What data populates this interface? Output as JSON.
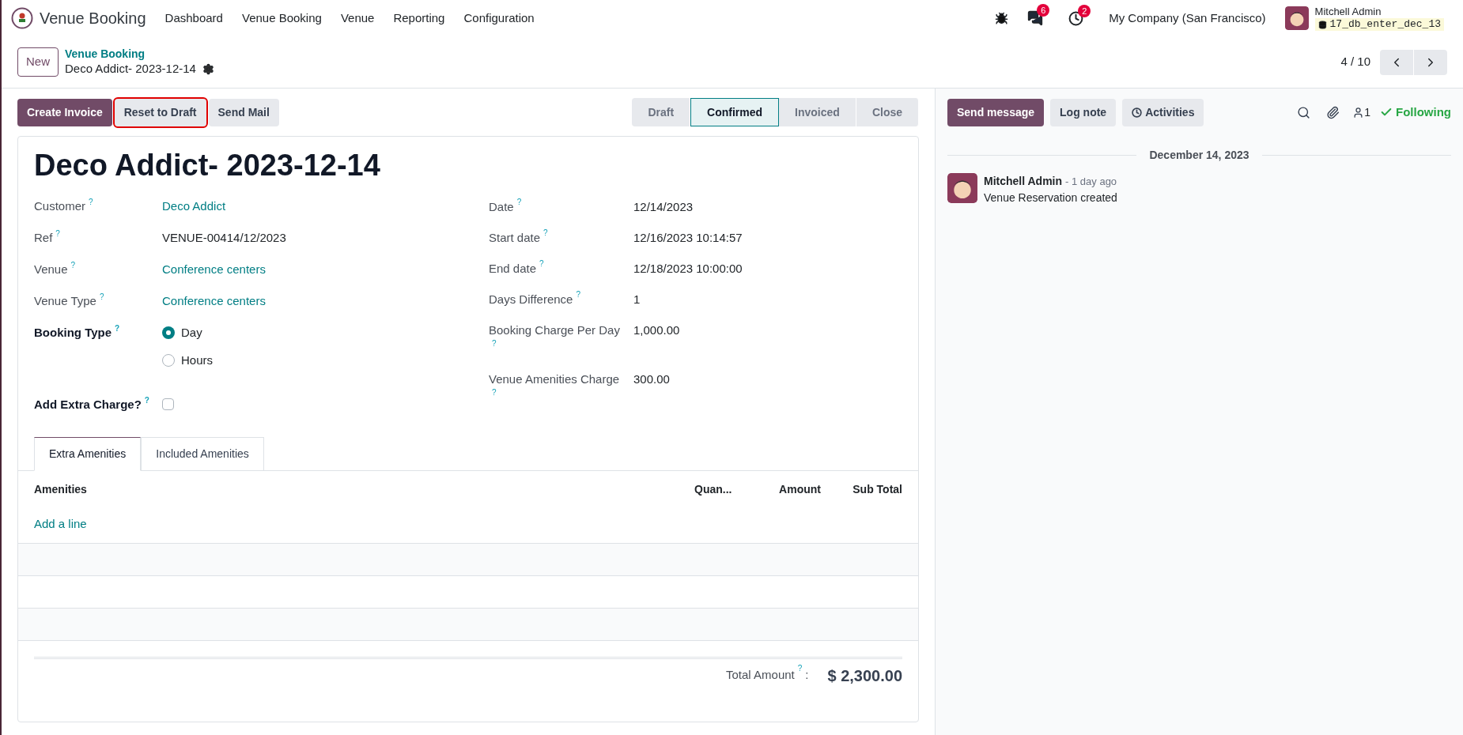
{
  "navbar": {
    "app_name": "Venue Booking",
    "menus": [
      "Dashboard",
      "Venue Booking",
      "Venue",
      "Reporting",
      "Configuration"
    ],
    "messages_count": "6",
    "activities_count": "2",
    "company": "My Company (San Francisco)",
    "user": "Mitchell Admin",
    "database": "17_db_enter_dec_13"
  },
  "control_panel": {
    "new_button": "New",
    "breadcrumb": "Venue Booking",
    "record_name": "Deco Addict- 2023-12-14",
    "pager": "4 / 10"
  },
  "actions": [
    {
      "label": "Create Invoice",
      "kind": "primary",
      "highlighted": false
    },
    {
      "label": "Reset to Draft",
      "kind": "secondary",
      "highlighted": true
    },
    {
      "label": "Send Mail",
      "kind": "secondary",
      "highlighted": false
    }
  ],
  "stages": [
    {
      "label": "Draft",
      "selected": false
    },
    {
      "label": "Confirmed",
      "selected": true
    },
    {
      "label": "Invoiced",
      "selected": false
    },
    {
      "label": "Close",
      "selected": false
    }
  ],
  "form": {
    "title": "Deco Addict- 2023-12-14",
    "help_mark": "?",
    "left_fields": [
      {
        "label": "Customer",
        "kind": "link",
        "value": "Deco Addict"
      },
      {
        "label": "Ref",
        "kind": "text",
        "value": "VENUE-00414/12/2023"
      },
      {
        "label": "Venue",
        "kind": "link",
        "value": "Conference centers"
      },
      {
        "label": "Venue Type",
        "kind": "link",
        "value": "Conference centers"
      },
      {
        "label": "Booking Type",
        "kind": "radio",
        "options": [
          {
            "label": "Day",
            "selected": true
          },
          {
            "label": "Hours",
            "selected": false
          }
        ]
      },
      {
        "label": "Add Extra Charge?",
        "kind": "checkbox",
        "checked": false
      }
    ],
    "right_fields": [
      {
        "label": "Date",
        "value": "12/14/2023"
      },
      {
        "label": "Start date",
        "value": "12/16/2023 10:14:57"
      },
      {
        "label": "End date",
        "value": "12/18/2023 10:00:00"
      },
      {
        "label": "Days Difference",
        "value": "1"
      },
      {
        "label": "Booking Charge Per Day",
        "value": "1,000.00"
      },
      {
        "label": "Venue Amenities Charge",
        "value": "300.00"
      }
    ],
    "tabs": [
      {
        "label": "Extra Amenities",
        "selected": true
      },
      {
        "label": "Included Amenities",
        "selected": false
      }
    ],
    "table": {
      "columns": [
        "Amenities",
        "Quan...",
        "Amount",
        "Sub Total"
      ],
      "add_line": "Add a line"
    },
    "total_label": "Total Amount",
    "total_help": "?",
    "total_colon": ":",
    "total_value": "$ 2,300.00"
  },
  "chatter": {
    "buttons": [
      {
        "label": "Send message",
        "kind": "primary"
      },
      {
        "label": "Log note",
        "kind": "secondary"
      },
      {
        "label": "Activities",
        "kind": "activity"
      }
    ],
    "followers_count": "1",
    "following": "Following",
    "date_separator": "December 14, 2023",
    "messages": [
      {
        "author": "Mitchell Admin",
        "time": "- 1 day ago",
        "body": "Venue Reservation created"
      }
    ]
  }
}
